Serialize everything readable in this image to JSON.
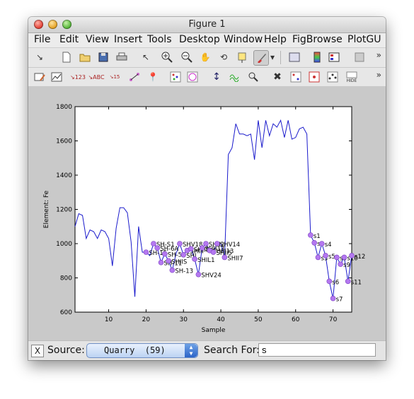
{
  "window": {
    "title": "Figure 1"
  },
  "menubar": {
    "items": [
      "File",
      "Edit",
      "View",
      "Insert",
      "Tools",
      "Desktop",
      "Window",
      "Help",
      "FigBrowse",
      "PlotGU"
    ]
  },
  "toolbar1": {
    "icons": [
      "arrow-icon",
      "new-file-icon",
      "open-folder-icon",
      "save-icon",
      "print-icon",
      "pointer-icon",
      "zoom-in-icon",
      "zoom-out-icon",
      "pan-hand-icon",
      "rotate-icon",
      "data-cursor-icon",
      "brush-icon",
      "link-plot-icon",
      "colorbar-icon",
      "legend-icon",
      "hide-tools-icon"
    ],
    "more": "»"
  },
  "toolbar2": {
    "icons": [
      "edit-plot-icon",
      "plot-tools-icon",
      "label-123-icon",
      "label-abc-icon",
      "label-152025-icon",
      "connect-points-icon",
      "text-label-icon",
      "points-icon",
      "select-points-icon",
      "arrows-icon",
      "wave-icon",
      "inspect-icon",
      "tools-icon",
      "select-grid-icon",
      "grid-points-icon",
      "scatter-points-icon"
    ],
    "hide_label": "HIDE",
    "more": "»"
  },
  "chart_data": {
    "type": "line",
    "xlabel": "Sample",
    "ylabel": "Element: Fe",
    "xlim": [
      1,
      75
    ],
    "ylim": [
      600,
      1800
    ],
    "x_ticks": [
      10,
      20,
      30,
      40,
      50,
      60,
      70
    ],
    "y_ticks": [
      600,
      800,
      1000,
      1200,
      1400,
      1600,
      1800
    ],
    "line_color": "#1a1acc",
    "marker_color": "#b478f0",
    "series": [
      {
        "x": [
          1,
          2,
          3,
          4,
          5,
          6,
          7,
          8,
          9,
          10,
          11,
          12,
          13,
          14,
          15,
          16,
          17,
          18,
          19,
          20,
          21,
          22,
          23,
          24,
          25,
          26,
          27,
          28,
          29,
          30,
          31,
          32,
          33,
          34,
          35,
          36,
          37,
          38,
          39,
          40,
          41,
          42,
          43,
          44,
          45,
          46,
          47,
          48,
          49,
          50,
          51,
          52,
          53,
          54,
          55,
          56,
          57,
          58,
          59,
          60,
          61,
          62,
          63,
          64,
          65,
          66,
          67,
          68,
          69,
          70,
          71,
          72,
          73,
          74,
          75
        ],
        "values": [
          1100,
          1175,
          1165,
          1030,
          1080,
          1070,
          1030,
          1080,
          1070,
          1030,
          870,
          1090,
          1210,
          1210,
          1180,
          1010,
          690,
          1100,
          950,
          950,
          930,
          1000,
          975,
          890,
          940,
          900,
          845,
          940,
          1000,
          935,
          960,
          970,
          910,
          820,
          975,
          1000,
          960,
          950,
          1000,
          1000,
          920,
          1520,
          1560,
          1700,
          1640,
          1640,
          1630,
          1640,
          1490,
          1720,
          1560,
          1720,
          1630,
          1700,
          1680,
          1720,
          1620,
          1720,
          1610,
          1620,
          1670,
          1680,
          1640,
          1050,
          1005,
          920,
          1000,
          930,
          780,
          680,
          920,
          880,
          920,
          780,
          930
        ]
      }
    ],
    "labeled_points": [
      {
        "x": 20,
        "y": 950,
        "label": "SH-15"
      },
      {
        "x": 22,
        "y": 1000,
        "label": "SH-S1"
      },
      {
        "x": 23,
        "y": 975,
        "label": "SH-6A"
      },
      {
        "x": 24,
        "y": 890,
        "label": "SH-11"
      },
      {
        "x": 25,
        "y": 940,
        "label": "SH-5"
      },
      {
        "x": 26,
        "y": 900,
        "label": "SHIIS"
      },
      {
        "x": 27,
        "y": 845,
        "label": "SH-13"
      },
      {
        "x": 29,
        "y": 1000,
        "label": "SHV18"
      },
      {
        "x": 30,
        "y": 935,
        "label": "SHI"
      },
      {
        "x": 31,
        "y": 960,
        "label": "SHIII"
      },
      {
        "x": 32,
        "y": 970,
        "label": "SHIIB"
      },
      {
        "x": 33,
        "y": 910,
        "label": "SHIL1"
      },
      {
        "x": 34,
        "y": 820,
        "label": "SHV24"
      },
      {
        "x": 35,
        "y": 975,
        "label": "SHII13"
      },
      {
        "x": 36,
        "y": 1000,
        "label": "SHII2"
      },
      {
        "x": 37,
        "y": 960,
        "label": "SHIII13"
      },
      {
        "x": 38,
        "y": 950,
        "label": "SHII5"
      },
      {
        "x": 39,
        "y": 1000,
        "label": "SHV14"
      },
      {
        "x": 41,
        "y": 920,
        "label": "SHII7"
      },
      {
        "x": 64,
        "y": 1050,
        "label": "s1"
      },
      {
        "x": 65,
        "y": 1005,
        "label": "s2"
      },
      {
        "x": 66,
        "y": 920,
        "label": "s3"
      },
      {
        "x": 67,
        "y": 1000,
        "label": "s4"
      },
      {
        "x": 68,
        "y": 930,
        "label": "s5"
      },
      {
        "x": 69,
        "y": 780,
        "label": "s6"
      },
      {
        "x": 70,
        "y": 680,
        "label": "s7"
      },
      {
        "x": 71,
        "y": 920,
        "label": "s8"
      },
      {
        "x": 72,
        "y": 880,
        "label": "s9"
      },
      {
        "x": 73,
        "y": 920,
        "label": "s10"
      },
      {
        "x": 74,
        "y": 780,
        "label": "s11"
      },
      {
        "x": 75,
        "y": 930,
        "label": "s12"
      }
    ]
  },
  "bottombar": {
    "close_label": "X",
    "source_label": "Source:",
    "source_value": "Quarry  (59)",
    "search_label": "Search For:",
    "search_value": "s"
  }
}
